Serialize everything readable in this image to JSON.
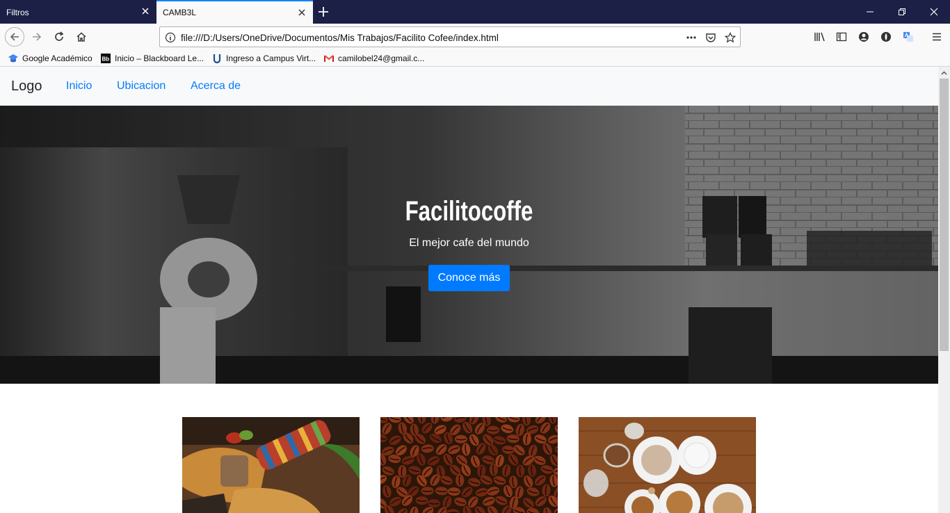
{
  "browser": {
    "tabs": [
      {
        "title": "Filtros",
        "active": false
      },
      {
        "title": "CAMB3L",
        "active": true
      }
    ],
    "url": "file:///D:/Users/OneDrive/Documentos/Mis Trabajos/Facilito Cofee/index.html",
    "accent": "#0a84ff",
    "bookmarks": [
      {
        "label": "Google Académico",
        "icon": "graduation-cap-icon"
      },
      {
        "label": "Inicio – Blackboard Le...",
        "icon": "blackboard-icon"
      },
      {
        "label": "Ingreso a Campus Virt...",
        "icon": "campus-icon"
      },
      {
        "label": "camilobel24@gmail.c...",
        "icon": "gmail-icon"
      }
    ]
  },
  "site": {
    "brand": "Logo",
    "nav": [
      "Inicio",
      "Ubicacion",
      "Acerca de"
    ],
    "hero": {
      "title": "Facilitocoffe",
      "subtitle": "El mejor cafe del mundo",
      "button": "Conoce más"
    },
    "link_color": "#007bff",
    "cards": [
      {
        "image": "food-photo"
      },
      {
        "image": "coffee-beans-photo"
      },
      {
        "image": "coffee-cups-photo"
      }
    ]
  }
}
